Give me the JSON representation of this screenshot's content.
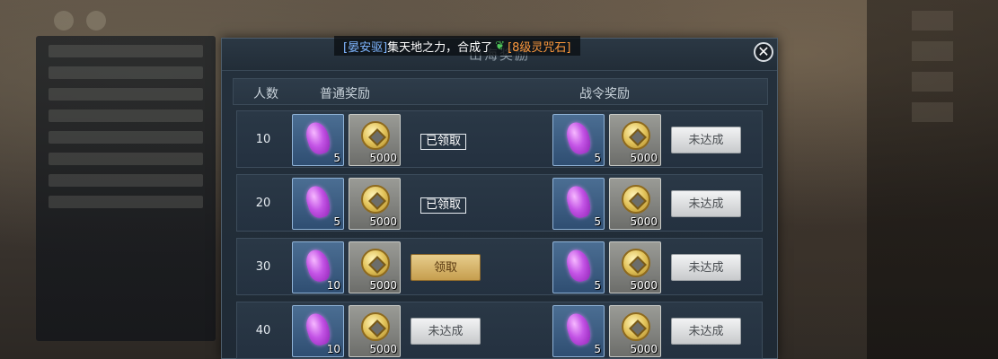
{
  "banner": {
    "player": "[晏安驱]",
    "message": "集天地之力，合成了",
    "item": "[8级灵咒石]",
    "leaf_icon": "green-leaf-icon"
  },
  "panel": {
    "title": "山海奖励",
    "columns": {
      "people": "人数",
      "normal": "普通奖励",
      "pass": "战令奖励"
    }
  },
  "rows": [
    {
      "count": "10",
      "normal_gem_qty": "5",
      "normal_coin_qty": "5000",
      "normal_status": "已领取",
      "pass_gem_qty": "5",
      "pass_coin_qty": "5000",
      "pass_status": "未达成"
    },
    {
      "count": "20",
      "normal_gem_qty": "5",
      "normal_coin_qty": "5000",
      "normal_status": "已领取",
      "pass_gem_qty": "5",
      "pass_coin_qty": "5000",
      "pass_status": "未达成"
    },
    {
      "count": "30",
      "normal_gem_qty": "10",
      "normal_coin_qty": "5000",
      "normal_status": "领取",
      "pass_gem_qty": "5",
      "pass_coin_qty": "5000",
      "pass_status": "未达成"
    },
    {
      "count": "40",
      "normal_gem_qty": "10",
      "normal_coin_qty": "5000",
      "normal_status": "未达成",
      "pass_gem_qty": "5",
      "pass_coin_qty": "5000",
      "pass_status": "未达成"
    }
  ],
  "colors": {
    "gem": "#c455e6",
    "coin": "#e2c35a",
    "claim_button": "#c69e4e",
    "locked_button": "#c8cacc"
  }
}
